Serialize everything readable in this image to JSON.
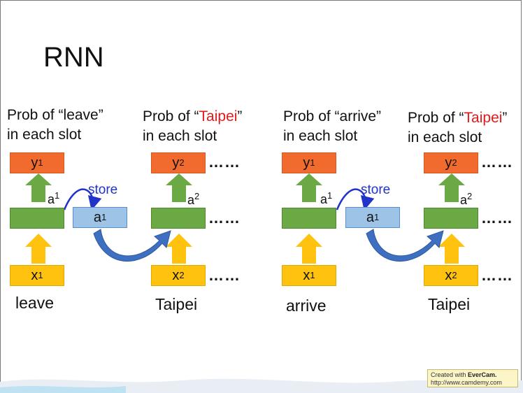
{
  "title": "RNN",
  "left": {
    "prob1": [
      "Prob of “leave”",
      "in each slot"
    ],
    "prob2_prefix": "Prob of “",
    "prob2_word": "Taipei",
    "prob2_suffix": "”",
    "prob2_line2": "in each slot",
    "word1": "leave",
    "word2": "Taipei",
    "word2_color": "#e21a1a"
  },
  "right": {
    "prob1": [
      "Prob of “arrive”",
      "in each slot"
    ],
    "prob2_prefix": "Prob of “",
    "prob2_word": "Taipei",
    "prob2_suffix": "”",
    "prob2_line2": "in each slot",
    "word1": "arrive",
    "word2": "Taipei",
    "word2_color": "#1ba84a"
  },
  "boxes": {
    "y": "y",
    "x": "x",
    "a": "a",
    "sup1": "1",
    "sup2": "2"
  },
  "store_label": "store",
  "dots": "……",
  "watermark": {
    "line1_prefix": "Created with ",
    "brand": "EverCam.",
    "line2": "http://www.camdemy.com"
  },
  "colors": {
    "output": "#f26b2e",
    "input": "#ffc20e",
    "hidden": "#6aa944",
    "memory": "#9dc3e6",
    "arrow_green": "#6aa944",
    "arrow_yellow": "#ffc20e",
    "arrow_blue": "#2233cc",
    "curve_blue": "#3e6fc0"
  }
}
